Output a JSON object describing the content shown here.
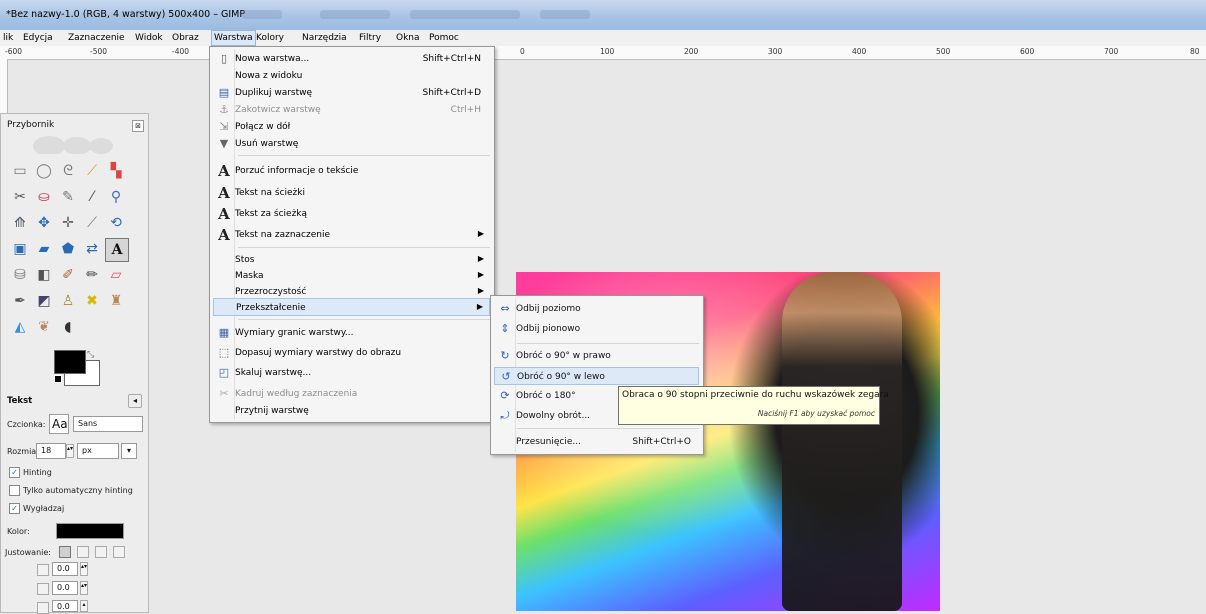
{
  "window": {
    "title": "*Bez nazwy-1.0 (RGB, 4 warstwy) 500x400 – GIMP"
  },
  "menubar": {
    "items": [
      "lik",
      "Edycja",
      "Zaznaczenie",
      "Widok",
      "Obraz",
      "Warstwa",
      "Kolory",
      "Narzędzia",
      "Filtry",
      "Okna",
      "Pomoc"
    ]
  },
  "ruler": {
    "labels": [
      "-600",
      "-500",
      "-400",
      "0",
      "100",
      "200",
      "300",
      "400",
      "500",
      "600",
      "700",
      "80"
    ]
  },
  "toolbox": {
    "title": "Przybornik",
    "close_glyph": "⊠",
    "tool_options_title": "Tekst",
    "font_label": "Czcionka:",
    "font_preview": "Aa",
    "font_value": "Sans",
    "size_label": "Rozmiar:",
    "size_value": "18",
    "size_unit": "px",
    "hinting_label": "Hinting",
    "hinting_checked": true,
    "autohint_label": "Tylko automatyczny hinting",
    "autohint_checked": false,
    "antialias_label": "Wygładzaj",
    "antialias_checked": true,
    "color_label": "Kolor:",
    "text_color": "#000000",
    "justify_label": "Justowanie:",
    "indent_value": "0.0",
    "line_spacing_value": "0.0",
    "letter_spacing_value": "0.0"
  },
  "layer_menu": {
    "items": [
      {
        "label": "Nowa warstwa...",
        "shortcut": "Shift+Ctrl+N",
        "icon": "new-layer-icon"
      },
      {
        "label": "Nowa z widoku",
        "shortcut": "",
        "icon": ""
      },
      {
        "label": "Duplikuj warstwę",
        "shortcut": "Shift+Ctrl+D",
        "icon": "duplicate-icon"
      },
      {
        "label": "Zakotwicz warstwę",
        "shortcut": "Ctrl+H",
        "icon": "anchor-icon",
        "disabled": true
      },
      {
        "label": "Połącz w dół",
        "shortcut": "",
        "icon": "merge-down-icon"
      },
      {
        "label": "Usuń warstwę",
        "shortcut": "",
        "icon": "trash-icon"
      },
      {
        "label": "Porzuć informacje o tekście",
        "shortcut": "",
        "icon": "text-icon"
      },
      {
        "label": "Tekst na ścieżki",
        "shortcut": "",
        "icon": "text-icon"
      },
      {
        "label": "Tekst za ścieżką",
        "shortcut": "",
        "icon": "text-icon"
      },
      {
        "label": "Tekst na zaznaczenie",
        "shortcut": "",
        "icon": "text-icon",
        "submenu": true
      },
      {
        "label": "Stos",
        "submenu": true
      },
      {
        "label": "Maska",
        "submenu": true
      },
      {
        "label": "Przezroczystość",
        "submenu": true
      },
      {
        "label": "Przekształcenie",
        "submenu": true,
        "highlighted": true
      },
      {
        "label": "Wymiary granic warstwy...",
        "icon": "layer-size-icon"
      },
      {
        "label": "Dopasuj wymiary warstwy do obrazu",
        "icon": "fit-layer-icon"
      },
      {
        "label": "Skaluj warstwę...",
        "icon": "scale-icon"
      },
      {
        "label": "Kadruj według zaznaczenia",
        "icon": "crop-icon",
        "disabled": true
      },
      {
        "label": "Przytnij warstwę"
      }
    ],
    "submenu_arrow": "▶"
  },
  "transform_submenu": {
    "items": [
      {
        "label": "Odbij poziomo",
        "shortcut": ""
      },
      {
        "label": "Odbij pionowo",
        "shortcut": ""
      },
      {
        "label": "Obróć o 90° w prawo",
        "shortcut": ""
      },
      {
        "label": "Obróć o 90° w lewo",
        "shortcut": "",
        "highlighted": true
      },
      {
        "label": "Obróć o 180°",
        "shortcut": ""
      },
      {
        "label": "Dowolny obrót...",
        "shortcut": ""
      },
      {
        "label": "Przesunięcie...",
        "shortcut": "Shift+Ctrl+O"
      }
    ]
  },
  "tooltip": {
    "text": "Obraca o 90 stopni przeciwnie do ruchu wskazówek zegara",
    "hint": "Naciśnij F1 aby uzyskać pomoc"
  }
}
